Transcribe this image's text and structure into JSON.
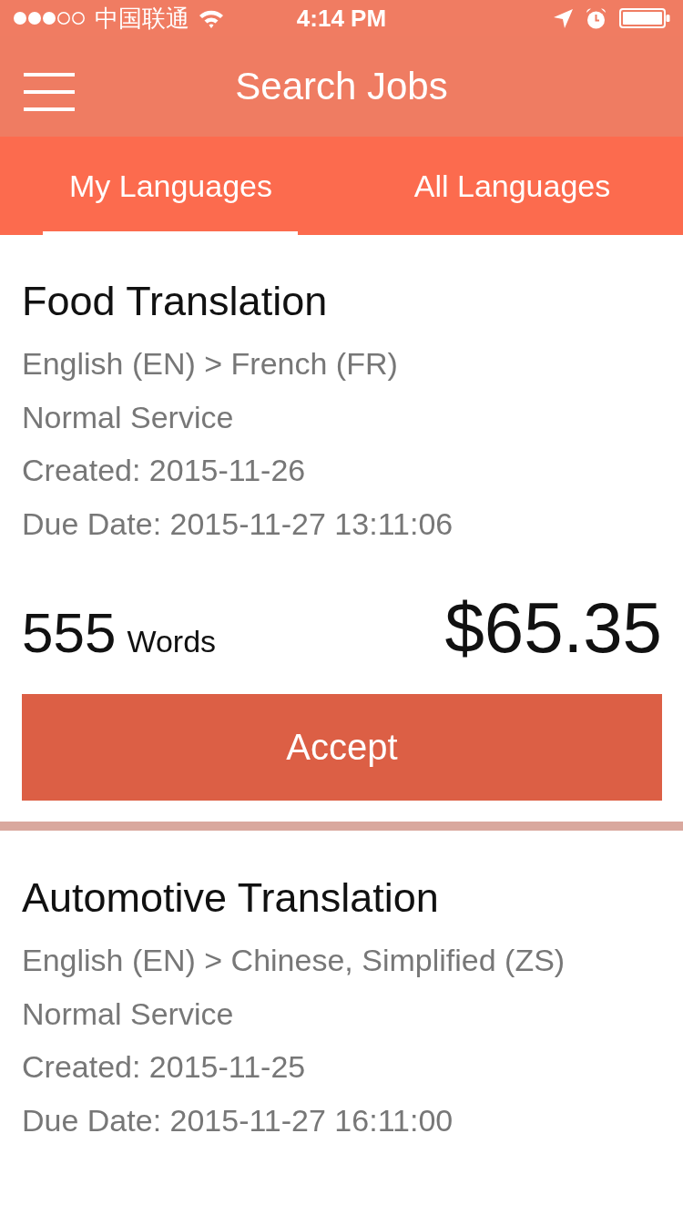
{
  "status_bar": {
    "carrier": "中国联通",
    "time": "4:14 PM"
  },
  "nav": {
    "title": "Search Jobs"
  },
  "tabs": [
    {
      "label": "My Languages",
      "selected": true
    },
    {
      "label": "All Languages",
      "selected": false
    }
  ],
  "jobs": [
    {
      "title": "Food Translation",
      "details": [
        "English (EN) > French (FR)",
        "Normal Service",
        "Created: 2015-11-26",
        "Due Date: 2015-11-27 13:11:06"
      ],
      "word_count": "555",
      "word_unit": "Words",
      "price": "$65.35",
      "action": "Accept"
    },
    {
      "title": "Automotive Translation",
      "details": [
        "English (EN) > Chinese, Simplified (ZS)",
        "Normal Service",
        "Created: 2015-11-25",
        "Due Date: 2015-11-27 16:11:00"
      ]
    }
  ]
}
